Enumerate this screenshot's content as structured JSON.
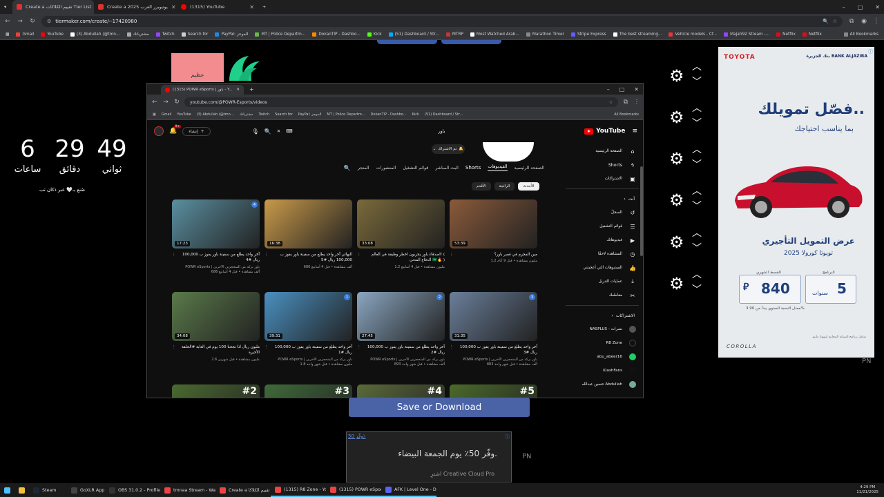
{
  "outer_tabs": [
    {
      "label": "Create a تقييم الكلاكات Tier List",
      "color": "#d33",
      "active": true
    },
    {
      "label": "Create a 2025 يوتيوبرز العرب",
      "color": "#d33",
      "active": false
    },
    {
      "label": "(1315) YouTube",
      "color": "#f00",
      "active": false
    }
  ],
  "outer_url": "tiermaker.com/create/--17420980",
  "bookmarks": [
    "Gmail",
    "YouTube",
    "(3) Abdullah (@tmn...",
    "مشترياتك",
    "Twitch",
    "Search for",
    "PayPal: الموجز",
    "MT | Police Departm...",
    "DokanTIP - Dashbo...",
    "Kick",
    "(51) Dashboard / Str...",
    "MTRP",
    "Most Watched Arab...",
    "Marathon Timer",
    "Stripe Express",
    "The best streaming...",
    "Vehicle models - Cf...",
    "Majah92 Stream -...",
    "Netflix",
    "Netflix"
  ],
  "all_bookmarks": "All Bookmarks",
  "timer": {
    "hours": "6",
    "hours_label": "ساعات",
    "minutes": "29",
    "minutes_label": "دقائق",
    "seconds": "49",
    "seconds_label": "ثواني",
    "credit": "صُنع بـ🤍 عبر ذكان تب"
  },
  "tier_label": "عظيم",
  "inner": {
    "tab": "(1315) POWR eSports | باور - Y...",
    "url": "youtube.com/@POWR-Esports/videos",
    "bookmarks": [
      "Gmail",
      "YouTube",
      "(3) Abdullah (@tmn...",
      "مشترياتك",
      "Twitch",
      "Search for",
      "PayPal: الموجز",
      "MT | Police Departm...",
      "DokanTIP - Dashbo...",
      "Kick",
      "(51) Dashboard / Str..."
    ],
    "all_bookmarks": "All Bookmarks"
  },
  "youtube": {
    "search_query": "باور",
    "create_label": "إنشاء",
    "notif_count": "9+",
    "logo_text": "YouTube",
    "subscribed_label": "تم الاشتراك",
    "channel_tabs": [
      "الصفحة الرئيسية",
      "الفيديوهات",
      "Shorts",
      "البث المباشر",
      "قوائم التشغيل",
      "المنشورات",
      "المتجر"
    ],
    "active_tab": "الفيديوهات",
    "chips": [
      "الأحدث",
      "الرائجة",
      "الأقدم"
    ],
    "sidebar_main": [
      "الصفحة الرئيسية",
      "Shorts",
      "الاشتراكات"
    ],
    "sidebar_you_header": "أنت",
    "sidebar_you": [
      "السجلّ",
      "قوائم التشغيل",
      "فيديوهاتك",
      "المشاهدة لاحقًا",
      "الفيديوهات التي أعجبتني",
      "عمليات التنزيل",
      "مقاطعك"
    ],
    "sidebar_subs_header": "الاشتراكات",
    "sidebar_subs": [
      "NASPLUS - نصرات",
      "R8 Zone",
      "abu_abeer16",
      "KlashFans",
      "حسين عبدالله Abdullah"
    ],
    "videos": [
      {
        "title": "آخر واحد يطلع من سفينة باور يفوز ب 100,000 ريال #4",
        "meta1": "POWR eSports | باور بركة من المتحجزين الآخرين",
        "meta2": "686 ألف مشاهدة • قبل 4 أسابيع",
        "dur": "17:23",
        "rank": "4",
        "color": "#5a8fa0"
      },
      {
        "title": "النهائي آخر واحد يطلع من سفينة باور يفوز ب 100,000 ريال #5",
        "meta1": "",
        "meta2": "680 ألف مشاهدة • قبل 4 أسابيع",
        "dur": "16:38",
        "rank": "",
        "color": "#c99a4a"
      },
      {
        "title": "اصدقاء باور يجربون اخطر وظيفة في العالم! ( الدفاع المدني 🇸🇦🔥 )",
        "meta1": "",
        "meta2": "1.2 مليون مشاهدة • قبل 4 أسابيع",
        "dur": "33:08",
        "rank": "",
        "color": "#7a6a3a"
      },
      {
        "title": "مين المجرم في قصر باور؟",
        "meta1": "",
        "meta2": "1.2 مليون مشاهدة • قبل 9 أيام",
        "dur": "53:39",
        "rank": "",
        "color": "#8a5a3a"
      },
      {
        "title": "مليون ريال اذا نجحنا 100 يوم في الغابة #الحلقة الأخيرة",
        "meta1": "",
        "meta2": "2.6 مليون مشاهدة • قبل شهرين",
        "dur": "34:08",
        "rank": "",
        "color": "#5a7a4a"
      },
      {
        "title": "آخر واحد يطلع من سفينة باور يفوز ب 100,000 ريال #1",
        "meta1": "POWR eSports | باور بركة من المتحجزين الآخرين",
        "meta2": "1.8 مليون مشاهدة • قبل شهر واحد",
        "dur": "39:31",
        "rank": "1",
        "color": "#4a90c0"
      },
      {
        "title": "آخر واحد يطلع من سفينة باور يفوز ب 100,000 ريال #2",
        "meta1": "POWR eSports | باور بركة من المتحجزين الآخرين",
        "meta2": "893 ألف مشاهدة • قبل شهر واحد",
        "dur": "27:45",
        "rank": "2",
        "color": "#8aa6c0"
      },
      {
        "title": "آخر واحد يطلع من سفينة باور يفوز ب 100,000 ريال #3",
        "meta1": "POWR eSports | باور بركة من المتحجزين الآخرين",
        "meta2": "883 ألف مشاهدة • قبل شهر واحد",
        "dur": "31:35",
        "rank": "3",
        "color": "#6a7f9a"
      },
      {
        "title": "",
        "meta1": "",
        "meta2": "",
        "dur": "",
        "rank": "#2",
        "color": "#4a6a30"
      },
      {
        "title": "",
        "meta1": "",
        "meta2": "",
        "dur": "",
        "rank": "#3",
        "color": "#3f6a3a"
      },
      {
        "title": "",
        "meta1": "",
        "meta2": "",
        "dur": "",
        "rank": "#4",
        "color": "#5a6a3a"
      },
      {
        "title": "",
        "meta1": "",
        "meta2": "",
        "dur": "",
        "rank": "#5",
        "color": "#4a6a2a"
      }
    ]
  },
  "ad": {
    "brand": "TOYOTA",
    "bank": "بنك الجزيرة BANK ALJAZIRA",
    "headline": "فصّل تمويلك..",
    "subhead": "بما يناسب احتياجك",
    "offer": "عرض التمويل التأجيري",
    "model": "تويوتا كورولا 2025",
    "program_label": "البرنامج",
    "program_value": "5",
    "program_unit": "سنوات",
    "monthly_label": "القسط الشهري",
    "monthly_value": "840",
    "currency": "⃁",
    "rate": "معدل النسبة السنوي يبدأ من 3.90%",
    "fine": "شامل برنامج الصيانة المجانية لتويوتا ماثيو",
    "car_name": "COROLLA"
  },
  "pn": "PN",
  "save_button": "Save or Download",
  "ad_bottom": {
    "link": "وفّر 50٪",
    "line1": "وفّر 50٪ يوم الجمعة البيضاء.",
    "line2": "اشترِ Creative Cloud Pro"
  },
  "taskbar": [
    {
      "label": "",
      "color": "#4cc2ff"
    },
    {
      "label": "",
      "color": "#f6c13a"
    },
    {
      "label": "Steam",
      "color": "#1b2838"
    },
    {
      "label": "GoXLR App",
      "color": "#444"
    },
    {
      "label": "OBS 31.0.2 - Profile:...",
      "color": "#333"
    },
    {
      "label": "tmnaa Stream - Wa...",
      "color": "#e44"
    },
    {
      "label": "Create a تقييم الكلاكا",
      "color": "#e44"
    },
    {
      "label": "(1315) R8 Zone - Yo...",
      "color": "#e44"
    },
    {
      "label": "(1315) POWR eSpor...",
      "color": "#e44"
    },
    {
      "label": "AFK | Level One - D...",
      "color": "#5865f2"
    }
  ],
  "clock": {
    "time": "4:29 PM",
    "date": "11/21/2025"
  }
}
